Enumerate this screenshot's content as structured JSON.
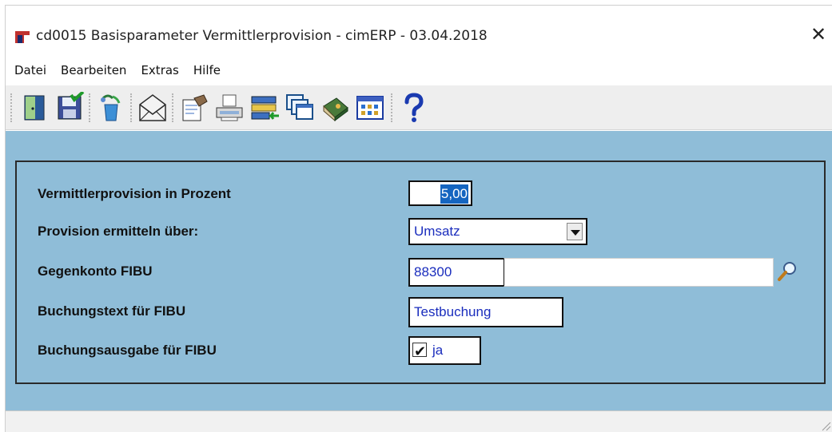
{
  "window": {
    "title": "cd0015 Basisparameter Vermittlerprovision - cimERP - 03.04.2018",
    "close_glyph": "✕"
  },
  "menu": {
    "items": [
      "Datei",
      "Bearbeiten",
      "Extras",
      "Hilfe"
    ]
  },
  "toolbar": {
    "buttons": [
      {
        "icon": "exit-door-icon"
      },
      {
        "icon": "save-floppy-icon"
      },
      {
        "icon": "recycle-refresh-icon"
      },
      {
        "icon": "mail-envelope-icon"
      },
      {
        "icon": "edit-document-icon"
      },
      {
        "icon": "printer-icon"
      },
      {
        "icon": "import-list-icon"
      },
      {
        "icon": "windows-stack-icon"
      },
      {
        "icon": "book-icon"
      },
      {
        "icon": "calendar-grid-icon"
      },
      {
        "icon": "help-question-icon"
      }
    ]
  },
  "form": {
    "provision_percent": {
      "label": "Vermittlerprovision in Prozent",
      "value": "5,00"
    },
    "provision_method": {
      "label": "Provision ermitteln über:",
      "value": "Umsatz"
    },
    "offset_account": {
      "label": "Gegenkonto FIBU",
      "value": "88300",
      "description": ""
    },
    "booking_text": {
      "label": "Buchungstext für FIBU",
      "value": "Testbuchung"
    },
    "booking_output": {
      "label": "Buchungsausgabe für FIBU",
      "checked": true,
      "value": "ja"
    }
  },
  "colors": {
    "client_bg": "#8fbdd8",
    "field_text": "#1a2dbd",
    "selection_bg": "#1565c0"
  }
}
